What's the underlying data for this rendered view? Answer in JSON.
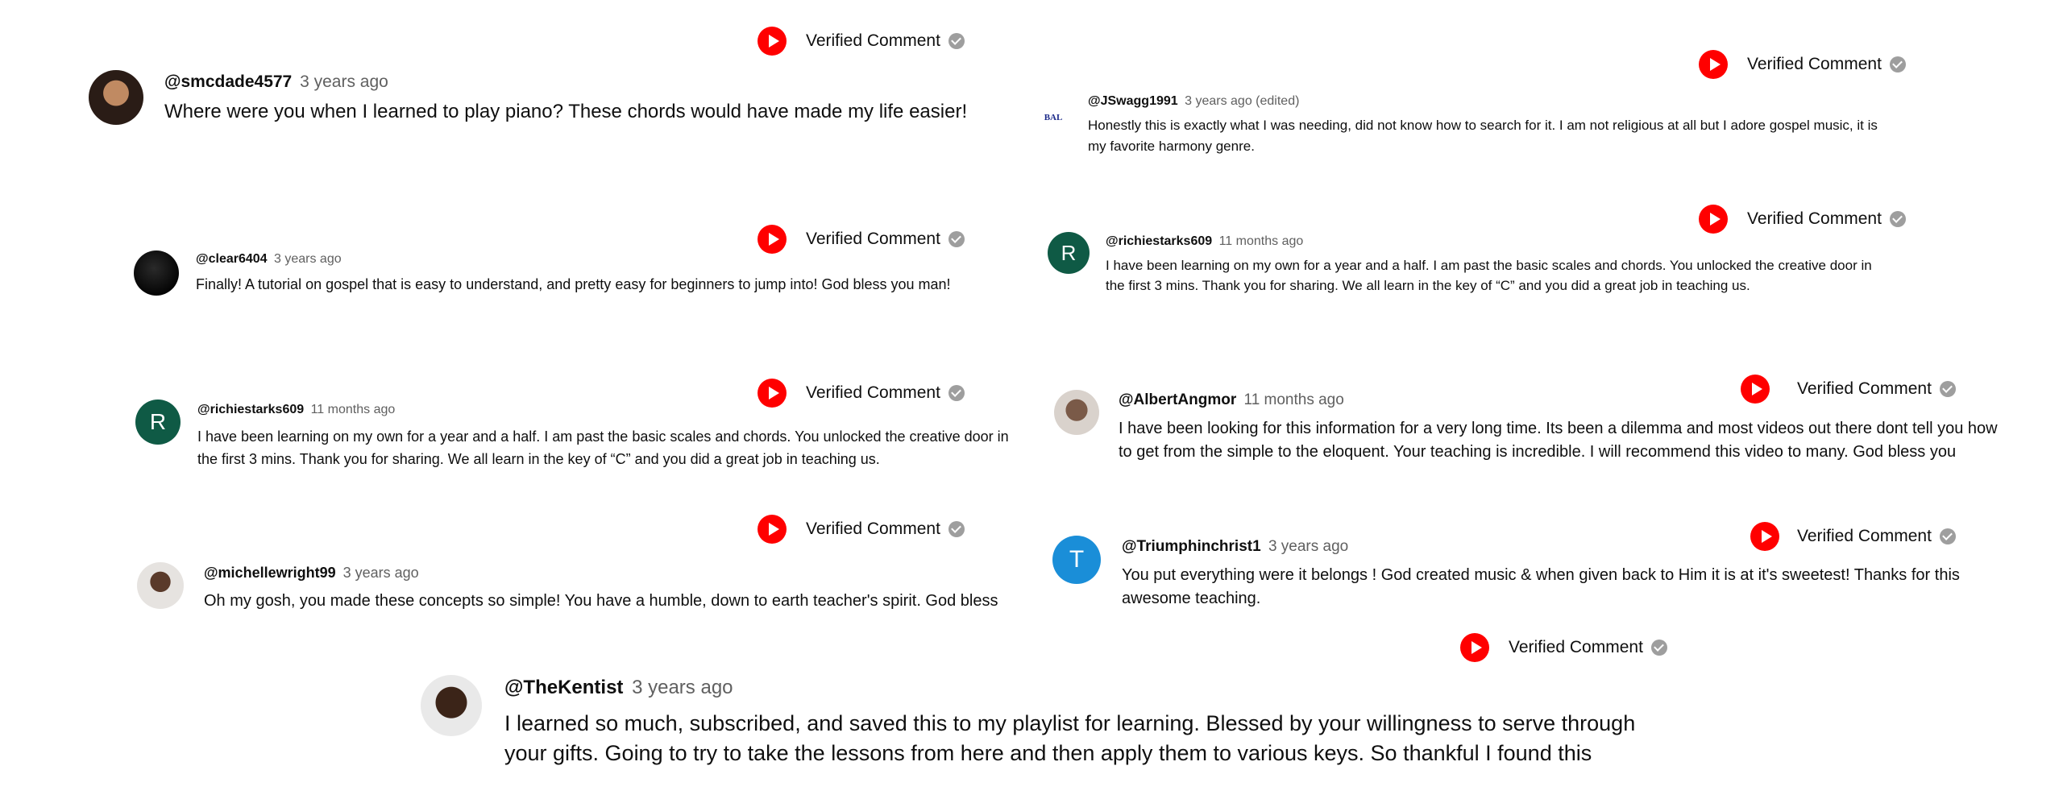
{
  "badge_label": "Verified Comment",
  "colors": {
    "play_red": "#ff0000",
    "check_gray": "#9e9e9e",
    "avatar_green": "#0f5a45",
    "avatar_blue": "#1a8ed8"
  },
  "icons": {
    "play": "play-icon",
    "check": "check-circle-icon"
  },
  "comments": [
    {
      "handle": "@smcdade4577",
      "time": "3 years ago",
      "text": "Where were you when I learned to play piano? These chords would have made my life easier!"
    },
    {
      "handle": "@JSwagg1991",
      "time": "3 years ago (edited)",
      "text": "Honestly this is exactly what I was needing, did not know how to search for it. I am not religious at all but I adore gospel music, it is my favorite harmony genre.",
      "avatar_text": "BAL"
    },
    {
      "handle": "@clear6404",
      "time": "3 years ago",
      "text": "Finally! A tutorial on gospel that is easy to understand, and pretty easy for beginners to jump into! God bless you man!"
    },
    {
      "handle": "@richiestarks609",
      "time": "11 months ago",
      "text": "I have been learning on my own for a year and a half. I am past the basic scales and chords. You unlocked the creative door in the first 3 mins. Thank you for sharing. We all learn in the key of “C” and you did a great job in teaching us.",
      "avatar_letter": "R"
    },
    {
      "handle": "@richiestarks609",
      "time": "11 months ago",
      "text": "I have been learning on my own for a year and a half. I am past the basic scales and chords. You unlocked the creative door in the first 3 mins. Thank you for sharing. We all learn in the key of “C” and you did a great job in teaching us.",
      "avatar_letter": "R"
    },
    {
      "handle": "@AlbertAngmor",
      "time": "11 months ago",
      "text": "I have been looking for this information for a very long time. Its been a dilemma and most videos out there dont tell you how to get from the simple to the eloquent. Your teaching is incredible. I will recommend this video to many. God bless you"
    },
    {
      "handle": "@michellewright99",
      "time": "3 years ago",
      "text": "Oh my gosh, you made these concepts so simple! You have a humble, down to earth teacher's spirit. God bless"
    },
    {
      "handle": "@Triumphinchrist1",
      "time": "3 years ago",
      "text": "You put everything were it belongs ! God created music & when given back to Him it is at it's sweetest! Thanks for this awesome teaching.",
      "avatar_letter": "T"
    },
    {
      "handle": "@TheKentist",
      "time": "3 years ago",
      "text": "I learned so much, subscribed, and saved this to my playlist for learning. Blessed by your willingness to serve through your gifts.  Going to try to take the lessons from here and then apply them to various keys. So thankful I found this"
    }
  ]
}
